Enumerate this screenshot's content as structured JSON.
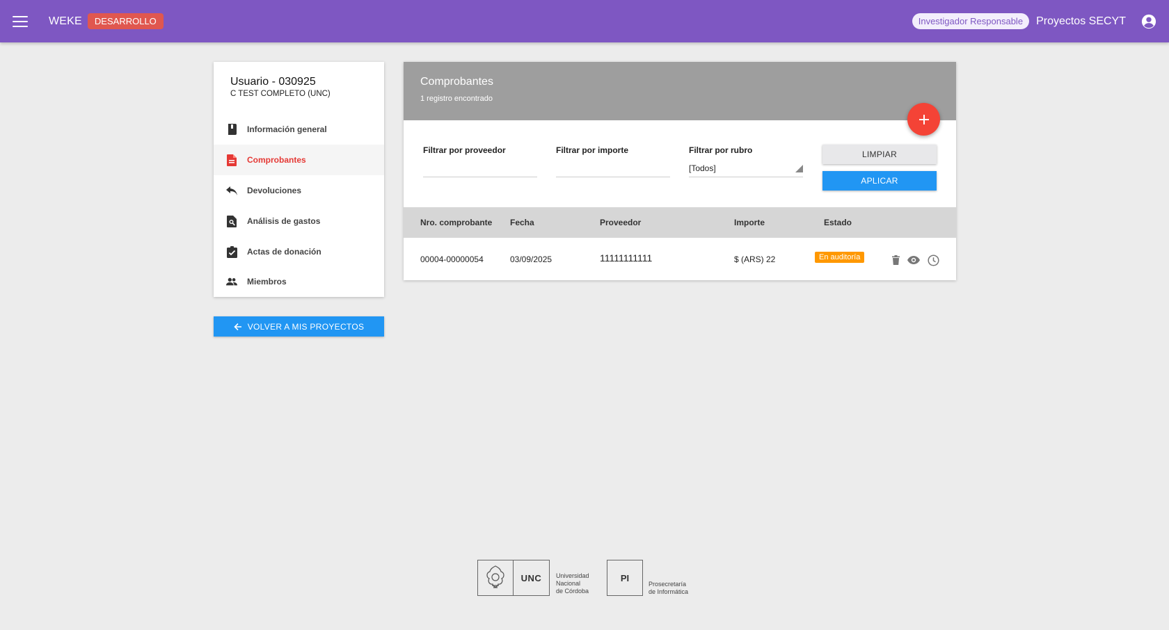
{
  "topbar": {
    "app_name": "WEKE",
    "env_badge": "DESARROLLO",
    "role": "Investigador Responsable",
    "project": "Proyectos SECYT"
  },
  "sidebar": {
    "user_title": "Usuario - 030925",
    "user_subtitle": "C TEST COMPLETO (UNC)",
    "items": [
      {
        "label": "Información general",
        "icon": "book-icon"
      },
      {
        "label": "Comprobantes",
        "icon": "document-icon",
        "active": true
      },
      {
        "label": "Devoluciones",
        "icon": "reply-icon"
      },
      {
        "label": "Análisis de gastos",
        "icon": "find-in-page-icon"
      },
      {
        "label": "Actas de donación",
        "icon": "assignment-check-icon"
      },
      {
        "label": "Miembros",
        "icon": "people-icon"
      }
    ],
    "back_button": "VOLVER A MIS PROYECTOS"
  },
  "main": {
    "title": "Comprobantes",
    "subtitle": "1 registro encontrado",
    "filters": {
      "provider_label": "Filtrar por proveedor",
      "provider_value": "",
      "amount_label": "Filtrar por importe",
      "amount_value": "",
      "category_label": "Filtrar por rubro",
      "category_value": "[Todos]"
    },
    "clear_button": "LIMPIAR",
    "apply_button": "APLICAR",
    "table": {
      "headers": [
        "Nro. comprobante",
        "Fecha",
        "Proveedor",
        "Importe",
        "Estado"
      ],
      "rows": [
        {
          "number": "00004-00000054",
          "date": "03/09/2025",
          "provider": "11111111111",
          "amount": "$ (ARS) 22",
          "status": "En auditoría"
        }
      ]
    }
  },
  "footer": {
    "unc_abbr": "UNC",
    "unc_name_1": "Universidad",
    "unc_name_2": "Nacional",
    "unc_name_3": "de Córdoba",
    "pi_abbr": "PI",
    "pi_name_1": "Prosecretaría",
    "pi_name_2": "de Informática"
  },
  "colors": {
    "topbar": "#7e57c2",
    "env_badge": "#e0574f",
    "primary_button": "#2196f3",
    "fab": "#f44336",
    "active_nav": "#e53935",
    "status_badge": "#ff9800"
  }
}
